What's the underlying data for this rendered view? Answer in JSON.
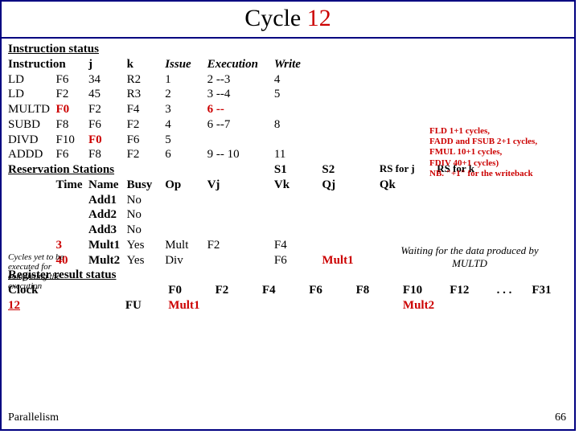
{
  "title": {
    "a": "Cycle ",
    "b": "12"
  },
  "sect1": "Instruction status",
  "hdr1": {
    "instr": "Instruction",
    "j": "j",
    "k": "k",
    "issue": "Issue",
    "exec": "Execution",
    "write": "Write"
  },
  "rows": [
    {
      "op": "LD",
      "d": "F6",
      "j": "34",
      "k": "R2",
      "issue": "1",
      "exec": "2 --3",
      "write": "4"
    },
    {
      "op": "LD",
      "d": "F2",
      "j": "45",
      "k": "R3",
      "issue": "2",
      "exec": "3 --4",
      "write": "5"
    },
    {
      "op": "MULTD",
      "d": "F0",
      "j": "F2",
      "k": "F4",
      "issue": "3",
      "exec": "6 --",
      "write": ""
    },
    {
      "op": "SUBD",
      "d": "F8",
      "j": "F6",
      "k": "F2",
      "issue": "4",
      "exec": "6 --7",
      "write": "8"
    },
    {
      "op": "DIVD",
      "d": "F10",
      "j": "F0",
      "k": "F6",
      "issue": "5",
      "exec": "",
      "write": ""
    },
    {
      "op": "ADDD",
      "d": "F6",
      "j": "F8",
      "k": "F2",
      "issue": "6",
      "exec": "9 -- 10",
      "write": "11"
    }
  ],
  "sect2": "Reservation Stations",
  "hdr2": {
    "s1": "S1",
    "s2": "S2",
    "rsj": "RS for j",
    "rsk": "RS for k",
    "time": "Time",
    "name": "Name",
    "busy": "Busy",
    "op": "Op",
    "vj": "Vj",
    "vk": "Vk",
    "qj": "Qj",
    "qk": "Qk"
  },
  "rs": [
    {
      "time": "",
      "name": "Add1",
      "busy": "No",
      "op": "",
      "vj": "",
      "vk": "",
      "qj": "",
      "qk": ""
    },
    {
      "time": "",
      "name": "Add2",
      "busy": "No",
      "op": "",
      "vj": "",
      "vk": "",
      "qj": "",
      "qk": ""
    },
    {
      "time": "",
      "name": "Add3",
      "busy": "No",
      "op": "",
      "vj": "",
      "vk": "",
      "qj": "",
      "qk": ""
    },
    {
      "time": "3",
      "name": "Mult1",
      "busy": "Yes",
      "op": "Mult",
      "vj": "F2",
      "vk": "F4",
      "qj": "",
      "qk": ""
    },
    {
      "time": "40",
      "name": "Mult2",
      "busy": "Yes",
      "op": "Div",
      "vj": "",
      "vk": "F6",
      "qj": "Mult1",
      "qk": ""
    }
  ],
  "sect3": "Register result status",
  "hdr3": {
    "clock": "Clock",
    "val": "12",
    "fu": "FU",
    "f0": "F0",
    "f2": "F2",
    "f4": "F4",
    "f6": "F6",
    "f8": "F8",
    "f10": "F10",
    "f12": "F12",
    "dots": ". . .",
    "f31": "F31"
  },
  "regres": {
    "f0": "Mult1",
    "f10": "Mult2"
  },
  "cyclenotes": "FLD 1+1 cycles,\nFADD and FSUB 2+1 cycles,\nFMUL 10+1 cycles,\nFDIV 40+1 cycles)\nNB. \"+1\" for the writeback",
  "sidenote": "Cycles yet to be executed for completing the execution",
  "waitnote": "Waiting for the data produced by MULTD",
  "footer": {
    "left": "Parallelism",
    "right": "66"
  }
}
